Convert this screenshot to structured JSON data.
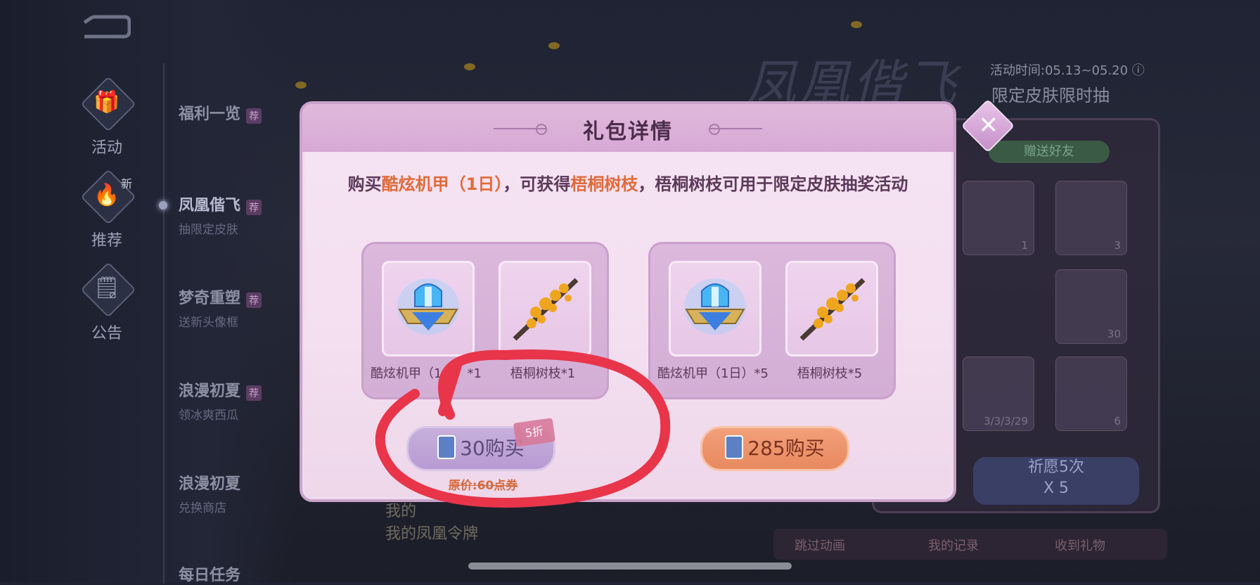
{
  "sidebar": {
    "tabs": [
      {
        "label": "活动"
      },
      {
        "label": "推荐",
        "badge": "新"
      },
      {
        "label": "公告"
      }
    ],
    "items": [
      {
        "title": "福利一览",
        "tag": "荐",
        "subtitle": ""
      },
      {
        "title": "凤凰偕飞",
        "tag": "荐",
        "subtitle": "抽限定皮肤"
      },
      {
        "title": "梦奇重塑",
        "tag": "荐",
        "subtitle": "送新头像框"
      },
      {
        "title": "浪漫初夏",
        "tag": "荐",
        "subtitle": "领冰爽西瓜"
      },
      {
        "title": "浪漫初夏",
        "tag": "",
        "subtitle": "兑换商店"
      },
      {
        "title": "每日任务",
        "tag": "",
        "subtitle": ""
      }
    ]
  },
  "event": {
    "banner_title": "凤凰偕飞",
    "time_label": "活动时间:05.13~05.20 ⓘ",
    "subtitle": "限定皮肤限时抽",
    "gift_button": "赠送好友",
    "grid_counts": [
      "1",
      "3",
      "30",
      "3/3/3/29",
      "6"
    ],
    "pray_line1": "祈愿5次",
    "pray_line2": "X 5",
    "bottom_links": [
      "跳过动画",
      "我的记录",
      "收到礼物"
    ],
    "my_lines": [
      "我的",
      "我的凤凰令牌"
    ]
  },
  "modal": {
    "title": "礼包详情",
    "desc_prefix": "购买",
    "desc_item1": "酷炫机甲（1日）",
    "desc_mid": "，可获得",
    "desc_item2": "梧桐树枝",
    "desc_suffix": "，梧桐树枝可用于限定皮肤抽奖活动",
    "packs": [
      {
        "items": [
          {
            "name": "酷炫机甲（1日）*1",
            "icon": "mecha-emblem-icon"
          },
          {
            "name": "梧桐树枝*1",
            "icon": "golden-branch-icon"
          }
        ],
        "button": "30购买",
        "discount": "5折",
        "original_price": "原价:60点券"
      },
      {
        "items": [
          {
            "name": "酷炫机甲（1日）*5",
            "icon": "mecha-emblem-icon"
          },
          {
            "name": "梧桐树枝*5",
            "icon": "golden-branch-icon"
          }
        ],
        "button": "285购买"
      }
    ],
    "close_icon": "close-icon"
  },
  "colors": {
    "highlight": "#e06b3a",
    "annotation": "#e8354a"
  }
}
